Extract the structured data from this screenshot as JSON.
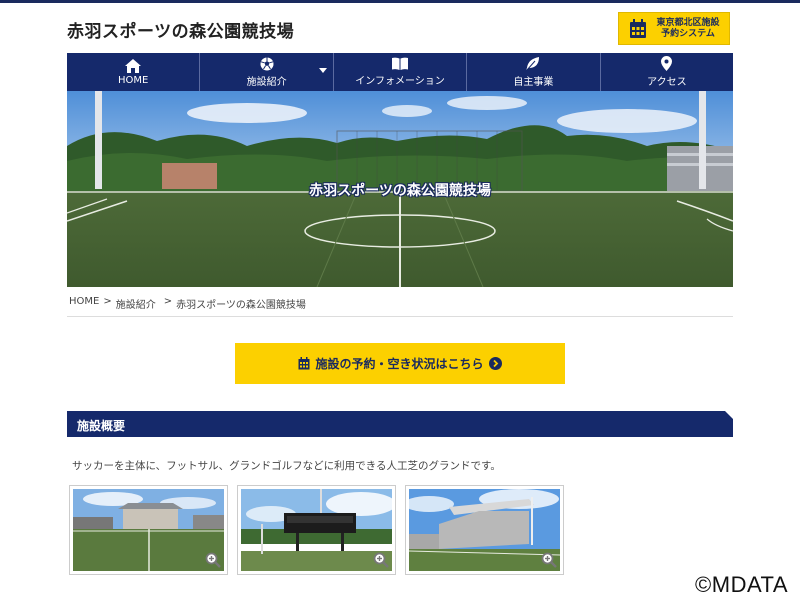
{
  "site": {
    "title": "赤羽スポーツの森公園競技場"
  },
  "reserve": {
    "label_line1": "東京都北区施設",
    "label_line2": "予約システム"
  },
  "nav": {
    "items": [
      {
        "label": "HOME",
        "icon": "home-icon"
      },
      {
        "label": "施設紹介",
        "icon": "soccer-ball-icon"
      },
      {
        "label": "インフォメーション",
        "icon": "book-icon"
      },
      {
        "label": "自主事業",
        "icon": "leaf-icon"
      },
      {
        "label": "アクセス",
        "icon": "map-pin-icon"
      }
    ]
  },
  "hero": {
    "title": "赤羽スポーツの森公園競技場"
  },
  "breadcrumb": {
    "home": "HOME",
    "sep1": ">",
    "level2": "施設紹介",
    "sep2": ">",
    "current": "赤羽スポーツの森公園競技場"
  },
  "cta": {
    "label": "施設の予約・空き状況はこちら"
  },
  "section": {
    "title": "施設概要",
    "description": "サッカーを主体に、フットサル、グランドゴルフなどに利用できる人工芝のグランドです。"
  },
  "footer": {
    "copyright": "©MDATA"
  },
  "colors": {
    "navy": "#15296b",
    "yellow": "#fcd000"
  }
}
